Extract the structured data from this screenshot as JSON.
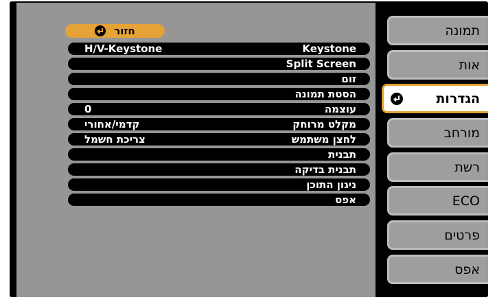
{
  "menu": {
    "items": [
      {
        "label": "תמונה"
      },
      {
        "label": "אות"
      },
      {
        "label": "הגדרות",
        "selected": true
      },
      {
        "label": "מורחב"
      },
      {
        "label": "רשת"
      },
      {
        "label": "ECO"
      },
      {
        "label": "פרטים"
      },
      {
        "label": "אפס"
      }
    ]
  },
  "submenu": {
    "back_label": "חזור",
    "rows": [
      {
        "name": "Keystone",
        "value": "H/V-Keystone"
      },
      {
        "name": "Split Screen",
        "value": ""
      },
      {
        "name": "זום",
        "value": ""
      },
      {
        "name": "הסטת תמונה",
        "value": ""
      },
      {
        "name": "עוצמה",
        "value": "0"
      },
      {
        "name": "מקלט מרוחק",
        "value": "קדמי/אחורי"
      },
      {
        "name": "לחצן משתמש",
        "value": "צריכת חשמל"
      },
      {
        "name": "תבנית",
        "value": ""
      },
      {
        "name": "תבנית בדיקה",
        "value": ""
      },
      {
        "name": "ניגון התוכן",
        "value": ""
      },
      {
        "name": "אפס",
        "value": ""
      }
    ]
  },
  "colors": {
    "highlight": "#e5a236",
    "tab": "#9e9e9e",
    "panel": "#969696"
  }
}
